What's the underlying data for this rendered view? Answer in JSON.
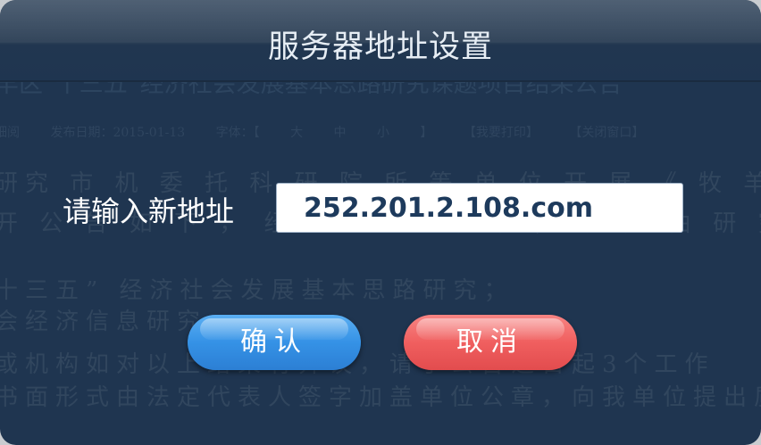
{
  "dialog": {
    "title": "服务器地址设置",
    "field_label": "请输入新地址",
    "address_value": "252.201.2.108.com",
    "confirm_label": "确认",
    "cancel_label": "取消"
  },
  "background_document": {
    "title": "羊区“十三五”经济社会发展基本思路研究课题项目结果公告",
    "meta": "细阅 发布日期：2015-01-13 字体：【 大 中 小 】 【我要打印】 【关闭窗口】",
    "para1": "研究 市 机 委 托 科 研 院 所 等 单 位 开 展 《 牧 羊 区 “ 十 三 五 ” 经",
    "para2": "开 公 告 如 下 ， 经 过 专 家 评 审 ， 确 定 由 研 究 所 和 专",
    "para3": "十三五” 经济社会发展基本思路研究；",
    "para4": "会经济信息研究",
    "para5": "或机构如对以上结果有异议，请于公告之日起3个工作",
    "para6": "书面形式由法定代表人签字加盖单位公章，向我单位提出质"
  },
  "colors": {
    "overlay": "#1f3550",
    "confirm_button": "#3592e6",
    "cancel_button": "#f05f5f",
    "input_text": "#1d3a5c"
  }
}
